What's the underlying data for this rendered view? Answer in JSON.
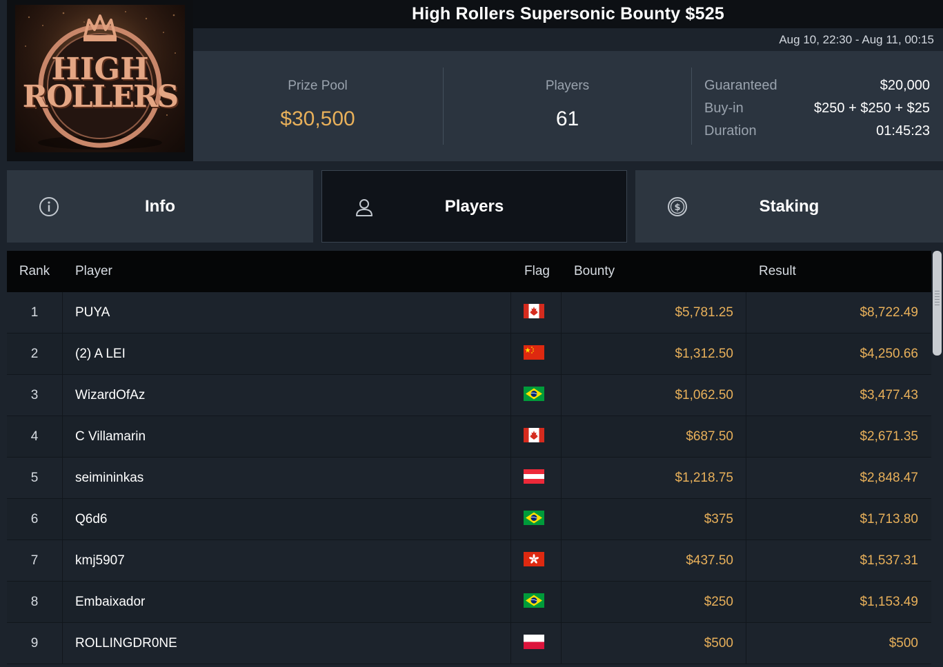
{
  "tournament": {
    "title": "High Rollers Supersonic Bounty $525",
    "date_range": "Aug 10, 22:30 - Aug 11, 00:15",
    "logo_lines": [
      "HIGH",
      "ROLLERS"
    ]
  },
  "stats": {
    "prize_pool_label": "Prize Pool",
    "prize_pool_value": "$30,500",
    "players_label": "Players",
    "players_value": "61"
  },
  "details": [
    {
      "label": "Guaranteed",
      "value": "$20,000"
    },
    {
      "label": "Buy-in",
      "value": "$250 + $250 + $25"
    },
    {
      "label": "Duration",
      "value": "01:45:23"
    }
  ],
  "tabs": [
    {
      "label": "Info",
      "icon": "info-icon",
      "active": false
    },
    {
      "label": "Players",
      "icon": "user-icon",
      "active": true
    },
    {
      "label": "Staking",
      "icon": "dollar-coin-icon",
      "active": false
    }
  ],
  "table": {
    "headers": {
      "rank": "Rank",
      "player": "Player",
      "flag": "Flag",
      "bounty": "Bounty",
      "result": "Result"
    },
    "rows": [
      {
        "rank": "1",
        "player": "PUYA",
        "flag": "canada",
        "bounty": "$5,781.25",
        "result": "$8,722.49"
      },
      {
        "rank": "2",
        "player": "(2) A LEI",
        "flag": "china",
        "bounty": "$1,312.50",
        "result": "$4,250.66"
      },
      {
        "rank": "3",
        "player": "WizardOfAz",
        "flag": "brazil",
        "bounty": "$1,062.50",
        "result": "$3,477.43"
      },
      {
        "rank": "4",
        "player": "C Villamarin",
        "flag": "canada",
        "bounty": "$687.50",
        "result": "$2,671.35"
      },
      {
        "rank": "5",
        "player": "seimininkas",
        "flag": "austria",
        "bounty": "$1,218.75",
        "result": "$2,848.47"
      },
      {
        "rank": "6",
        "player": "Q6d6",
        "flag": "brazil",
        "bounty": "$375",
        "result": "$1,713.80"
      },
      {
        "rank": "7",
        "player": "kmj5907",
        "flag": "hong-kong",
        "bounty": "$437.50",
        "result": "$1,537.31"
      },
      {
        "rank": "8",
        "player": "Embaixador",
        "flag": "brazil",
        "bounty": "$250",
        "result": "$1,153.49"
      },
      {
        "rank": "9",
        "player": "ROLLINGDR0NE",
        "flag": "poland",
        "bounty": "$500",
        "result": "$500"
      }
    ]
  },
  "colors": {
    "accent_gold": "#e8b05a",
    "background": "#1c232c",
    "panel": "#2b343f",
    "header_black": "#050607"
  }
}
